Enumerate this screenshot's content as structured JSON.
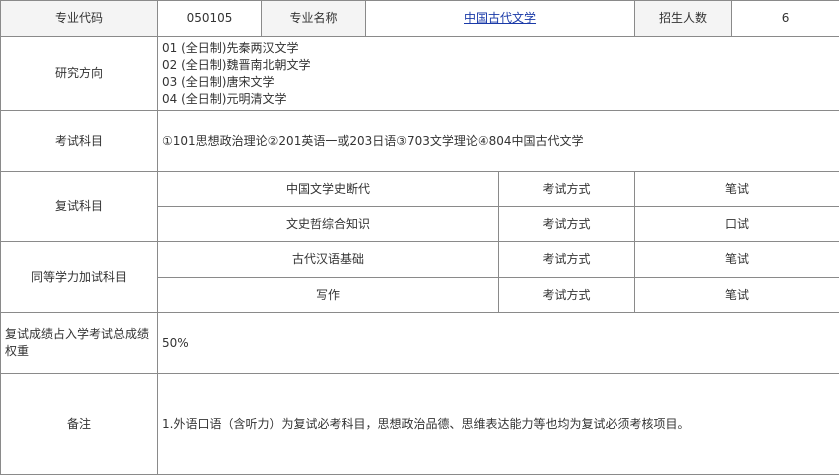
{
  "header": {
    "code_label": "专业代码",
    "code_value": "050105",
    "name_label": "专业名称",
    "name_value": "中国古代文学",
    "quota_label": "招生人数",
    "quota_value": "6"
  },
  "research": {
    "label": "研究方向",
    "items": [
      "01 (全日制)先秦两汉文学",
      "02 (全日制)魏晋南北朝文学",
      "03 (全日制)唐宋文学",
      "04 (全日制)元明清文学"
    ]
  },
  "exam": {
    "label": "考试科目",
    "value": "①101思想政治理论②201英语一或203日语③703文学理论④804中国古代文学"
  },
  "retest": {
    "label": "复试科目",
    "rows": [
      {
        "subject": "中国文学史断代",
        "method_label": "考试方式",
        "method": "笔试"
      },
      {
        "subject": "文史哲综合知识",
        "method_label": "考试方式",
        "method": "口试"
      }
    ]
  },
  "equivalent": {
    "label": "同等学力加试科目",
    "rows": [
      {
        "subject": "古代汉语基础",
        "method_label": "考试方式",
        "method": "笔试"
      },
      {
        "subject": "写作",
        "method_label": "考试方式",
        "method": "笔试"
      }
    ]
  },
  "weight": {
    "label": "复试成绩占入学考试总成绩权重",
    "value": "50%"
  },
  "remarks": {
    "label": "备注",
    "value": "1.外语口语（含听力）为复试必考科目，思想政治品德、思维表达能力等也均为复试必须考核项目。"
  },
  "colors": {
    "border": "#8a8a8a",
    "link": "#1a3aa8",
    "text": "#333333"
  }
}
